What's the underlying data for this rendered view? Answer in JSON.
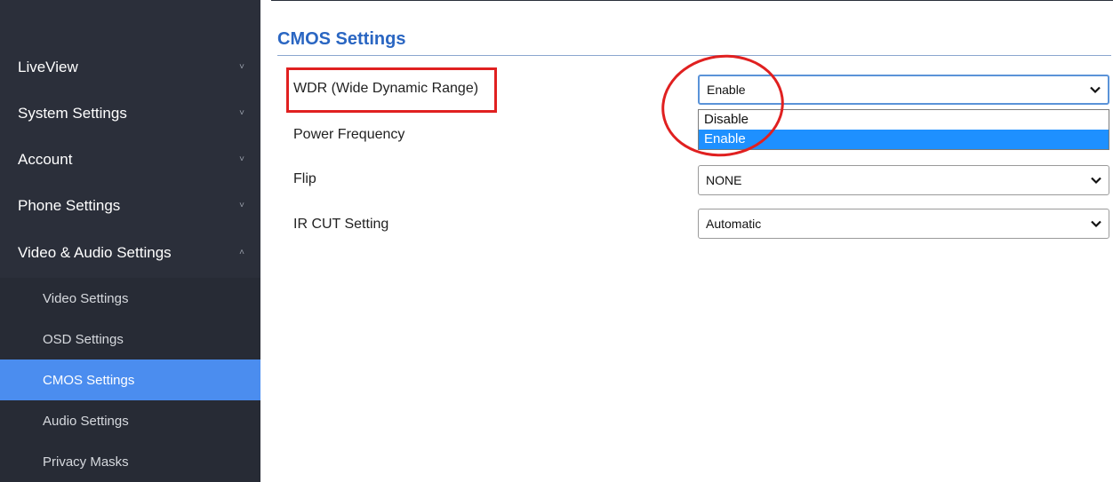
{
  "sidebar": {
    "items": [
      {
        "label": "LiveView",
        "chevron": "˅"
      },
      {
        "label": "System Settings",
        "chevron": "˅"
      },
      {
        "label": "Account",
        "chevron": "˅"
      },
      {
        "label": "Phone Settings",
        "chevron": "˅"
      },
      {
        "label": "Video & Audio Settings",
        "chevron": "˄"
      }
    ],
    "subitems": [
      {
        "label": "Video Settings"
      },
      {
        "label": "OSD Settings"
      },
      {
        "label": "CMOS Settings",
        "active": true
      },
      {
        "label": "Audio Settings"
      },
      {
        "label": "Privacy Masks"
      }
    ]
  },
  "page": {
    "title": "CMOS Settings"
  },
  "form": {
    "wdr": {
      "label": "WDR (Wide Dynamic Range)",
      "value": "Enable",
      "options": [
        "Disable",
        "Enable"
      ],
      "selected_option": "Enable"
    },
    "power_frequency": {
      "label": "Power Frequency"
    },
    "flip": {
      "label": "Flip",
      "value": "NONE"
    },
    "ir_cut": {
      "label": "IR CUT Setting",
      "value": "Automatic"
    }
  },
  "colors": {
    "sidebar_bg": "#2b2f3a",
    "active_item": "#4b8def",
    "title": "#2a66c2",
    "annotation_red": "#e02020",
    "option_highlight": "#1e90ff"
  }
}
